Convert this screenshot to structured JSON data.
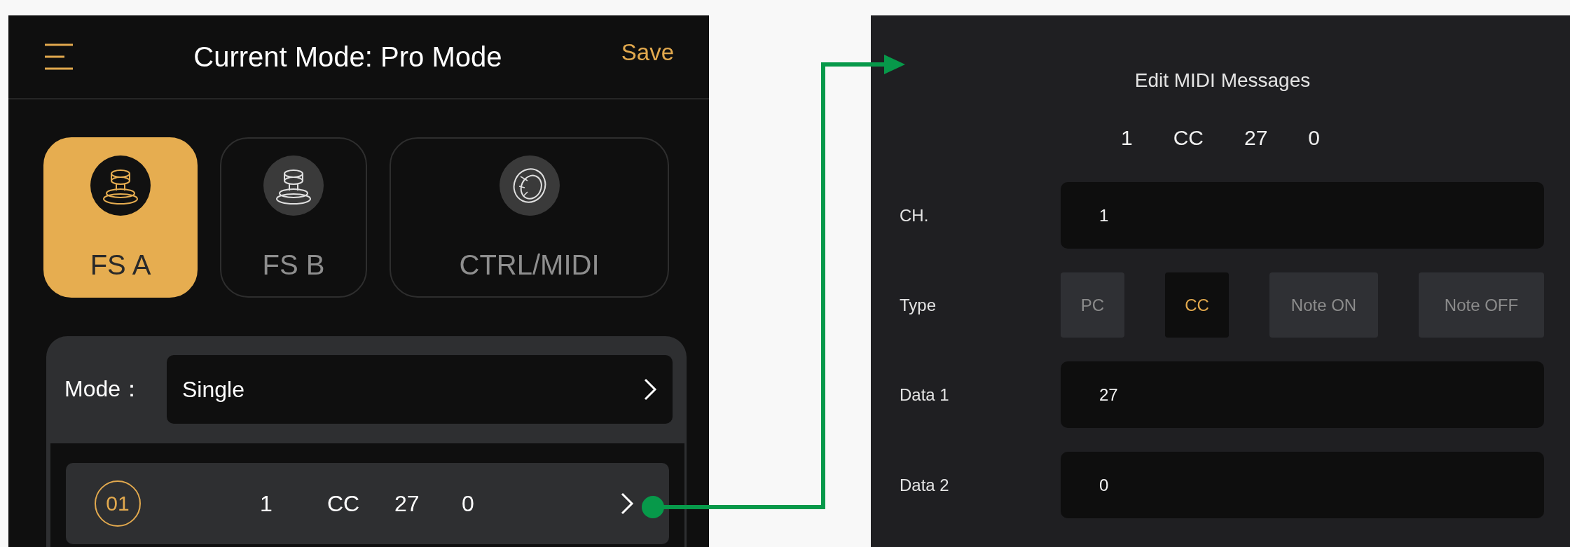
{
  "header": {
    "title": "Current Mode: Pro Mode",
    "save": "Save"
  },
  "tabs": [
    {
      "label": "FS A",
      "selected": true,
      "kind": "footswitch"
    },
    {
      "label": "FS B",
      "selected": false,
      "kind": "footswitch"
    },
    {
      "label": "CTRL/MIDI",
      "selected": false,
      "kind": "knob"
    }
  ],
  "mode": {
    "label": "Mode：",
    "value": "Single"
  },
  "messages": [
    {
      "index": "01",
      "values": [
        "1",
        "CC",
        "27",
        "0"
      ]
    }
  ],
  "editor": {
    "title": "Edit MIDI Messages",
    "summary": [
      "1",
      "CC",
      "27",
      "0"
    ],
    "fields": [
      {
        "label": "CH.",
        "kind": "input",
        "value": "1"
      },
      {
        "label": "Type",
        "kind": "choice",
        "options": [
          {
            "label": "PC",
            "selected": false
          },
          {
            "label": "CC",
            "selected": true
          },
          {
            "label": "Note ON",
            "selected": false
          },
          {
            "label": "Note OFF",
            "selected": false
          }
        ]
      },
      {
        "label": "Data 1",
        "kind": "input",
        "value": "27"
      },
      {
        "label": "Data 2",
        "kind": "input",
        "value": "0"
      }
    ]
  }
}
